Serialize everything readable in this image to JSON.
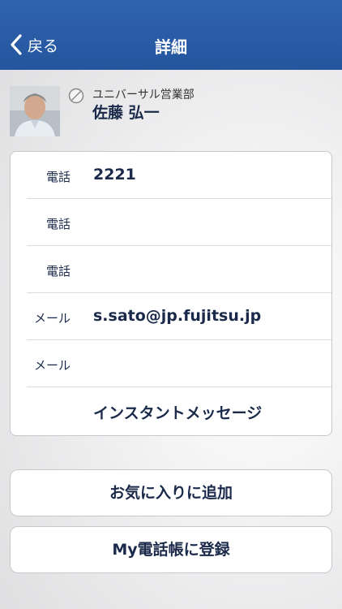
{
  "nav": {
    "back_label": "戻る",
    "title": "詳細"
  },
  "profile": {
    "department": "ユニバーサル営業部",
    "name": "佐藤 弘一"
  },
  "contact_rows": [
    {
      "label": "電話",
      "value": "2221"
    },
    {
      "label": "電話",
      "value": ""
    },
    {
      "label": "電話",
      "value": ""
    },
    {
      "label": "メール",
      "value": "s.sato@jp.fujitsu.jp"
    },
    {
      "label": "メール",
      "value": ""
    },
    {
      "label": "",
      "value": "インスタントメッセージ"
    }
  ],
  "actions": {
    "add_favorite": "お気に入りに追加",
    "register_my_phonebook": "My電話帳に登録"
  },
  "colors": {
    "nav_bar": "#2a5ca6",
    "text_dark": "#1b2a4a"
  }
}
